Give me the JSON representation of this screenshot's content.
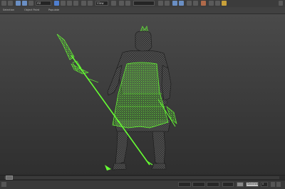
{
  "toolbar": {
    "selection_filter": "All",
    "view_dropdown": "View",
    "named_selection": ""
  },
  "ribbon": {
    "items": [
      "Selection",
      "Object Paint",
      "Populate"
    ]
  },
  "viewport": {
    "label": "",
    "selection_color": "#66ff33",
    "wire_color": "#1c1c1c"
  },
  "status": {
    "x_value": "",
    "y_value": "",
    "z_value": "",
    "grid_value": "",
    "set_key": "Selected",
    "frame": "0",
    "auto_key": ""
  }
}
